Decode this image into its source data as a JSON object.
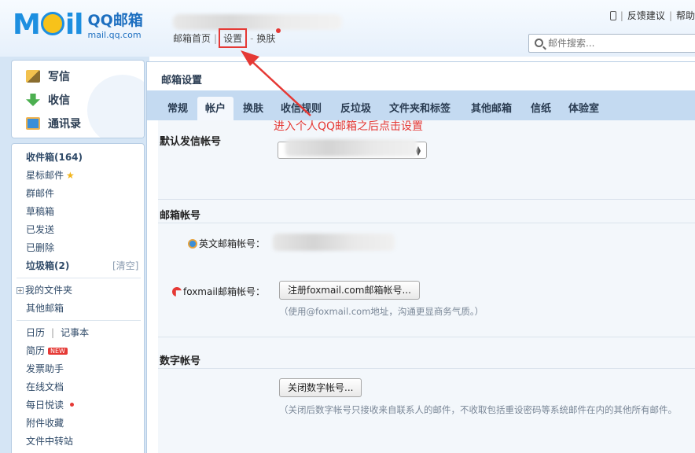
{
  "header": {
    "logo_mail": "Mail",
    "logo_brand": "QQ邮箱",
    "logo_url": "mail.qq.com",
    "nav": [
      "邮箱首页",
      "设置",
      "换肤"
    ],
    "top_links": [
      "反馈建议",
      "帮助"
    ],
    "search_placeholder": "邮件搜索..."
  },
  "sidebar": {
    "actions": [
      "写信",
      "收信",
      "通讯录"
    ],
    "folders": {
      "inbox": "收件箱(164)",
      "starred": "星标邮件",
      "group": "群邮件",
      "drafts": "草稿箱",
      "sent": "已发送",
      "deleted": "已删除",
      "spam": "垃圾箱(2)",
      "spam_clear": "[清空]",
      "my_folders": "我的文件夹",
      "other_mail": "其他邮箱",
      "calendar": "日历",
      "notepad": "记事本",
      "resume": "简历",
      "resume_badge": "NEW",
      "invoice": "发票助手",
      "docs": "在线文档",
      "daily": "每日悦读",
      "attachments": "附件收藏",
      "transfer": "文件中转站"
    }
  },
  "main": {
    "title": "邮箱设置",
    "tabs": [
      "常规",
      "帐户",
      "换肤",
      "收信规则",
      "反垃圾",
      "文件夹和标签",
      "其他邮箱",
      "信纸",
      "体验室"
    ],
    "active_tab": "帐户",
    "sections": {
      "default_sender": "默认发信帐号",
      "mailbox_account": "邮箱帐号",
      "english_label": "英文邮箱帐号：",
      "foxmail_label": "foxmail邮箱帐号：",
      "foxmail_button": "注册foxmail.com邮箱帐号...",
      "foxmail_note": "（使用@foxmail.com地址，沟通更显商务气质。）",
      "digital_account": "数字帐号",
      "digital_button": "关闭数字帐号...",
      "digital_note": "（关闭后数字帐号只接收来自联系人的邮件，不收取包括重设密码等系统邮件在内的其他所有邮件。"
    }
  },
  "annotation": {
    "text": "进入个人QQ邮箱之后点击设置",
    "color": "#e53935"
  }
}
